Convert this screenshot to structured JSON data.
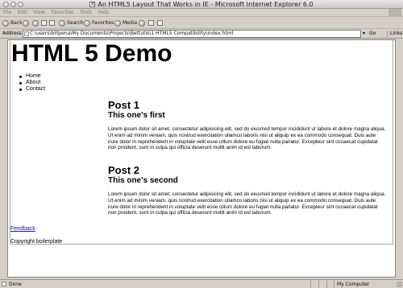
{
  "window": {
    "title": "An HTML5 Layout That Works in IE - Microsoft Internet Explorer 6.0",
    "title_icon": "X"
  },
  "menu": [
    "File",
    "Edit",
    "View",
    "Favorites",
    "Tools",
    "Help"
  ],
  "toolbar": {
    "back": "Back",
    "forward_icon": "forward-icon",
    "search": "Search",
    "favorites": "Favorites",
    "media": "Media"
  },
  "address": {
    "label": "Address",
    "value": "C:\\users\\billpena\\My Documents\\Projects\\Bettutis\\1 HTML5 Compatibility\\index.html",
    "go": "Go",
    "links": "Links"
  },
  "page": {
    "heading": "HTML 5 Demo",
    "nav": [
      "Home",
      "About",
      "Contact"
    ],
    "posts": [
      {
        "title": "Post 1",
        "subtitle": "This one's first",
        "body": "Lorem ipsum dolor sit amet, consectetur adipisicing elit, sed do eiusmod tempor incididunt ut labore et dolore magna aliqua. Ut enim ad minim veniam, quis nostrud exercitation ullamco laboris nisi ut aliquip ex ea commodo consequat. Duis aute irure dolor in reprehenderit in voluptate velit esse cillum dolore eu fugiat nulla pariatur. Excepteur sint occaecat cupidatat non proident, sunt in culpa qui officia deserunt mollit anim id est laborum."
      },
      {
        "title": "Post 2",
        "subtitle": "This one's second",
        "body": "Lorem ipsum dolor sit amet, consectetur adipisicing elit, sed do eiusmod tempor incididunt ut labore et dolore magna aliqua. Ut enim ad minim veniam, quis nostrud exercitation ullamco laboris nisi ut aliquip ex ea commodo consequat. Duis aute irure dolor in reprehenderit in voluptate velit esse cillum dolore eu fugiat nulla pariatur. Excepteur sint occaecat cupidatat non proident, sunt in culpa qui officia deserunt mollit anim id est laborum."
      }
    ],
    "feedback": "Feedback",
    "copyright": "Copyright boilerplate"
  },
  "status": {
    "text": "Done",
    "zone": "My Computer"
  }
}
